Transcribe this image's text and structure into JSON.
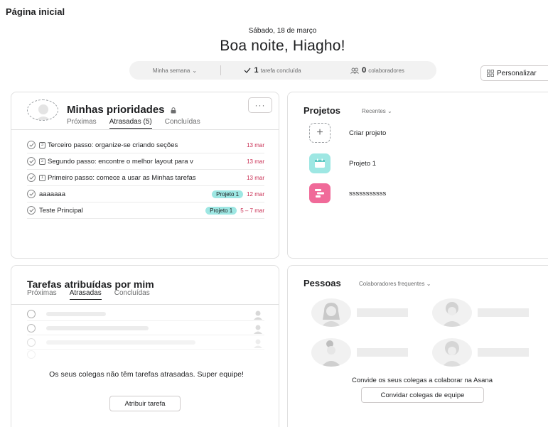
{
  "page": {
    "title": "Página inicial"
  },
  "header": {
    "date": "Sábado, 18 de março",
    "greeting": "Boa noite, Hiagho!"
  },
  "stats": {
    "week_label": "Minha semana",
    "tasks_count": "1",
    "tasks_label": "tarefa concluída",
    "collab_count": "0",
    "collab_label": "colaboradores"
  },
  "personalize_label": "Personalizar",
  "priorities": {
    "title": "Minhas prioridades",
    "tabs": [
      {
        "label": "Próximas",
        "active": false
      },
      {
        "label": "Atrasadas (5)",
        "active": true
      },
      {
        "label": "Concluídas",
        "active": false
      }
    ],
    "tasks": [
      {
        "number": "3",
        "name": "Terceiro passo: organize-se criando seções",
        "tag": "",
        "date": "13 mar"
      },
      {
        "number": "2",
        "name": "Segundo passo: encontre o melhor layout para v",
        "tag": "",
        "date": "13 mar"
      },
      {
        "number": "1",
        "name": "Primeiro passo: comece a usar as Minhas tarefas",
        "tag": "",
        "date": "13 mar"
      },
      {
        "number": "",
        "name": "aaaaaaa",
        "tag": "Projeto 1",
        "date": "12 mar"
      },
      {
        "number": "",
        "name": "Teste Principal",
        "tag": "Projeto 1",
        "date": "5 – 7 mar"
      }
    ]
  },
  "projects": {
    "title": "Projetos",
    "filter": "Recentes",
    "create_label": "Criar projeto",
    "items": [
      {
        "name": "Projeto 1",
        "color": "#9ee7e3"
      },
      {
        "name": "sssssssssss",
        "color": "#f06a99"
      }
    ]
  },
  "assigned": {
    "title": "Tarefas atribuídas por mim",
    "tabs": [
      {
        "label": "Próximas",
        "active": false
      },
      {
        "label": "Atrasadas",
        "active": true
      },
      {
        "label": "Concluídas",
        "active": false
      }
    ],
    "empty_message": "Os seus colegas não têm tarefas atrasadas. Super equipe!",
    "assign_button": "Atribuir tarefa"
  },
  "people": {
    "title": "Pessoas",
    "filter": "Colaboradores frequentes",
    "invite_message": "Convide os seus colegas a colaborar na Asana",
    "invite_button": "Convidar colegas de equipe"
  },
  "colors": {
    "tag_bg": "#9ee7e3",
    "overdue": "#c92f54",
    "project_teal": "#9ee7e3",
    "project_pink": "#f06a99"
  }
}
